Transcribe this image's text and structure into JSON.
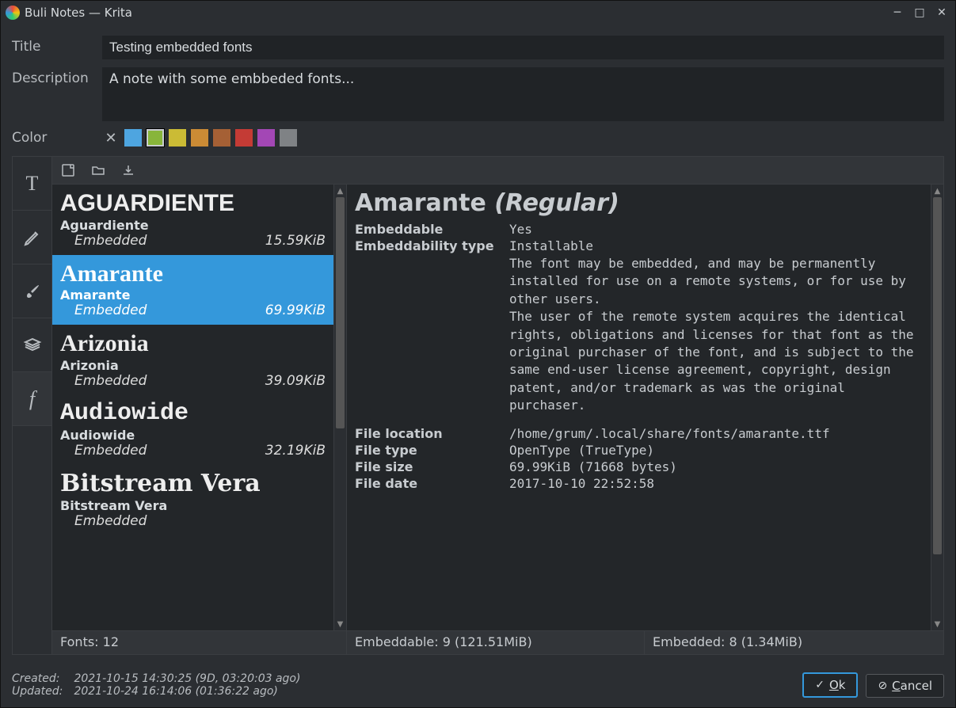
{
  "window": {
    "title": "Buli Notes — Krita"
  },
  "form": {
    "title_label": "Title",
    "title_value": "Testing embedded fonts",
    "desc_label": "Description",
    "desc_value": "A note with some embbeded fonts...",
    "color_label": "Color"
  },
  "swatches": [
    "#4ea5e0",
    "#88b53a",
    "#cbbb35",
    "#cb8b35",
    "#a56035",
    "#c43b35",
    "#a347b5",
    "#7f8285"
  ],
  "fonts": [
    {
      "big": "AGUARDIENTE",
      "name": "Aguardiente",
      "state": "Embedded",
      "size": "15.59KiB",
      "selected": false,
      "font": "Impact,'Arial Black',sans-serif"
    },
    {
      "big": "Amarante",
      "name": "Amarante",
      "state": "Embedded",
      "size": "69.99KiB",
      "selected": true,
      "font": "'Book Antiqua',Georgia,serif"
    },
    {
      "big": "Arizonia",
      "name": "Arizonia",
      "state": "Embedded",
      "size": "39.09KiB",
      "selected": false,
      "font": "'Brush Script MT',cursive"
    },
    {
      "big": "Audiowide",
      "name": "Audiowide",
      "state": "Embedded",
      "size": "32.19KiB",
      "selected": false,
      "font": "'Bauhaus 93','Courier New',monospace"
    },
    {
      "big": "Bitstream Vera",
      "name": "Bitstream Vera",
      "state": "Embedded",
      "size": "",
      "selected": false,
      "font": "'DejaVu Serif',Georgia,serif"
    }
  ],
  "details": {
    "title_name": "Amarante ",
    "title_style": "(Regular)",
    "embeddable_k": "Embeddable",
    "embeddable_v": "Yes",
    "embtype_k": "Embeddability type",
    "embtype_v": "Installable",
    "desc1": "The font may be embedded, and may be permanently installed for use on a remote systems, or for use by other users.",
    "desc2": "The user of the remote system acquires the identical rights, obligations and licenses for that font as the original purchaser of the font, and is subject to the same end-user license agreement, copyright, design patent, and/or trademark as was the original purchaser.",
    "loc_k": "File location",
    "loc_v": "/home/grum/.local/share/fonts/amarante.ttf",
    "type_k": "File type",
    "type_v": "OpenType (TrueType)",
    "size_k": "File size",
    "size_v": "69.99KiB (71668 bytes)",
    "date_k": "File date",
    "date_v": "2017-10-10 22:52:58"
  },
  "status": {
    "fonts": "Fonts: 12",
    "embeddable": "Embeddable: 9 (121.51MiB)",
    "embedded": "Embedded: 8 (1.34MiB)"
  },
  "timestamps": {
    "created_l": "Created:",
    "created_v": "2021-10-15 14:30:25 (9D, 03:20:03 ago)",
    "updated_l": "Updated:",
    "updated_v": "2021-10-24 16:14:06 (01:36:22 ago)"
  },
  "buttons": {
    "ok": "Ok",
    "cancel": "Cancel"
  }
}
